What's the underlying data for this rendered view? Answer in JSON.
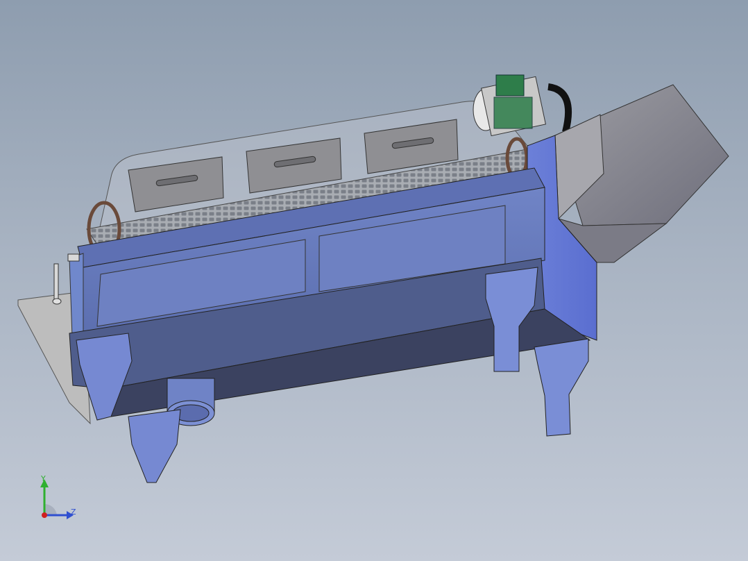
{
  "view": {
    "background_top": "#8e9daf",
    "background_bottom": "#c4cbd7"
  },
  "model": {
    "description_icon": "drum-screen-machine-3d-model",
    "colors": {
      "frame_blue": "#6f83c6",
      "frame_dark": "#3a4361",
      "hopper_gray": "#8a8a92",
      "motor_green": "#2e7d4a",
      "screen_gray": "#9aa0a8"
    }
  },
  "triad": {
    "y_label": "Y",
    "z_label": "Z",
    "y_color": "#2fb02f",
    "z_color": "#2f4fd0",
    "x_color": "#d02020"
  }
}
